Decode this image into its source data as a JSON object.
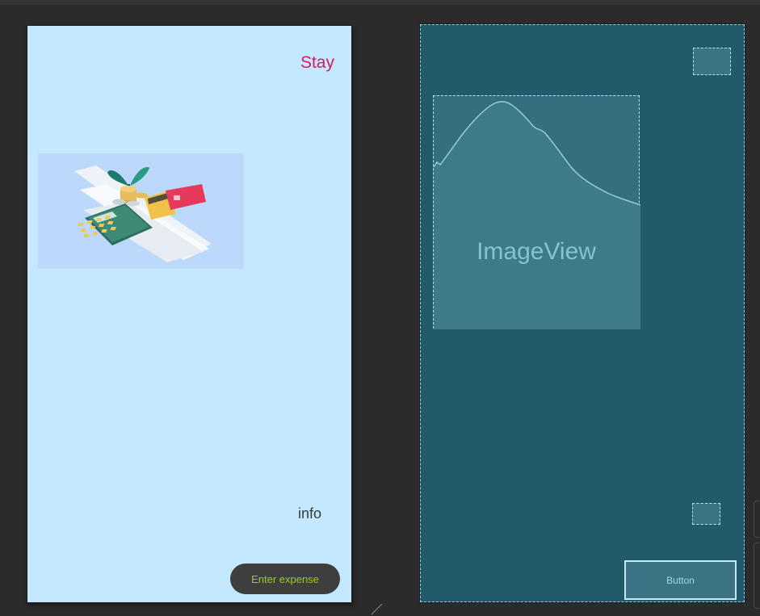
{
  "design": {
    "title_text": "Stay",
    "info_text": "info",
    "enter_button_label": "Enter expense",
    "colors": {
      "background": "#c4e8ff",
      "title": "#d81b60",
      "button_bg": "#3e3e3e",
      "button_text": "#9ccc1e"
    }
  },
  "blueprint": {
    "imageview_label": "ImageView",
    "button_label": "Button",
    "colors": {
      "background": "#215a6b",
      "outline": "#b3e4ec"
    }
  }
}
